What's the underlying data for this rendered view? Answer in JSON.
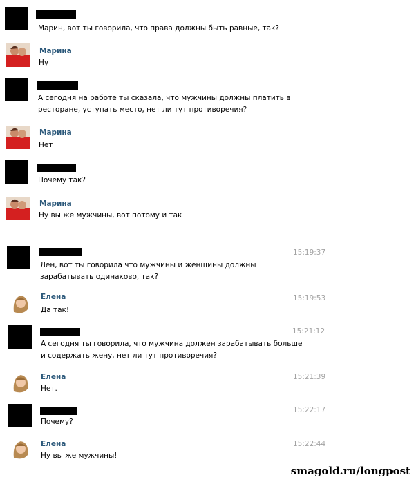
{
  "chat": {
    "part1": [
      {
        "sender": "",
        "text": "Марин, вот ты говорила, что права должны быть равные, так?"
      },
      {
        "sender": "Марина",
        "text": "Ну"
      },
      {
        "sender": "",
        "text": "А сегодня на работе ты сказала, что мужчины должны платить в\nресторане, уступать место, нет ли тут противоречия?"
      },
      {
        "sender": "Марина",
        "text": "Нет"
      },
      {
        "sender": "",
        "text": "Почему так?"
      },
      {
        "sender": "Марина",
        "text": "Ну вы же мужчины, вот потому и так"
      }
    ],
    "part2": [
      {
        "sender": "",
        "text": "Лен, вот ты говорила что мужчины и женщины должны\nзарабатывать одинаково, так?",
        "time": "15:19:37"
      },
      {
        "sender": "Елена",
        "text": "Да так!",
        "time": "15:19:53"
      },
      {
        "sender": "",
        "text": "А сегодня ты говорила, что мужчина должен зарабатывать больше\nи содержать жену, нет ли тут противоречия?",
        "time": "15:21:12"
      },
      {
        "sender": "Елена",
        "text": "Нет.",
        "time": "15:21:39"
      },
      {
        "sender": "",
        "text": "Почему?",
        "time": "15:22:17"
      },
      {
        "sender": "Елена",
        "text": "Ну вы же мужчины!",
        "time": "15:22:44"
      }
    ]
  },
  "watermark": "smagold.ru/longpost",
  "colors": {
    "name": "#2b587a",
    "time": "#a3a3a3",
    "redacted": "#000000"
  }
}
